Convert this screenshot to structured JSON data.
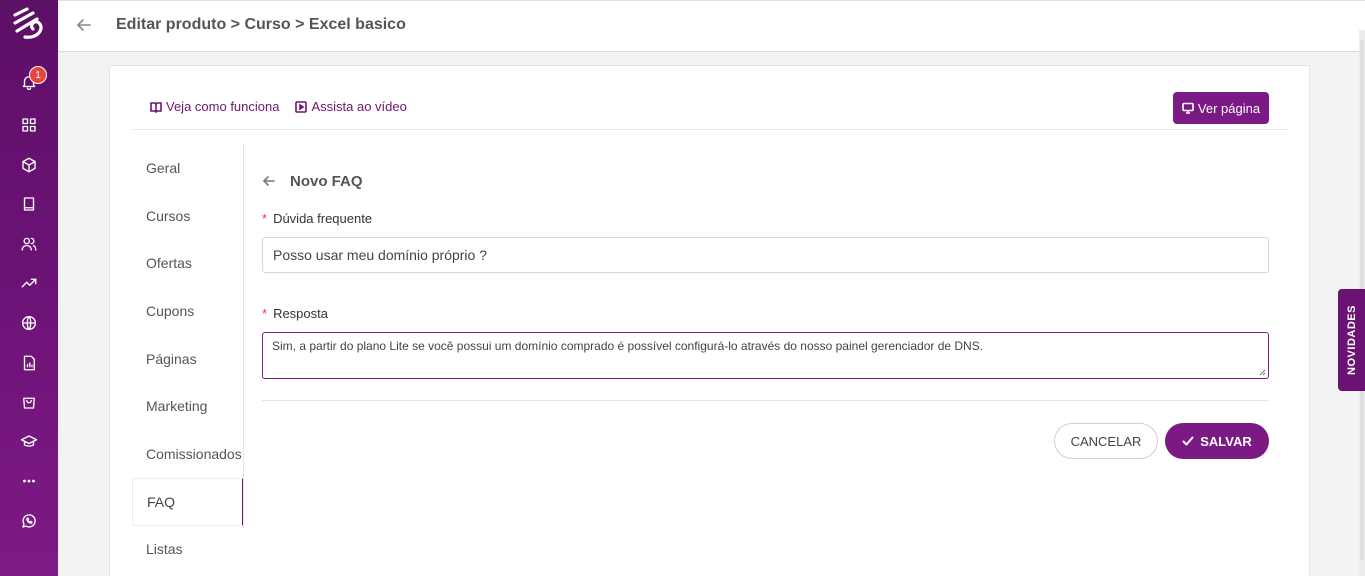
{
  "notifications": {
    "count": "1"
  },
  "header": {
    "breadcrumb": "Editar produto > Curso > Excel basico"
  },
  "toplinks": {
    "how_it_works": "Veja como funciona",
    "watch_video": "Assista ao vídeo"
  },
  "view_page_button": "Ver página",
  "tabs": [
    {
      "label": "Geral"
    },
    {
      "label": "Cursos"
    },
    {
      "label": "Ofertas"
    },
    {
      "label": "Cupons"
    },
    {
      "label": "Páginas"
    },
    {
      "label": "Marketing"
    },
    {
      "label": "Comissionados"
    },
    {
      "label": "FAQ"
    },
    {
      "label": "Listas"
    }
  ],
  "active_tab": "FAQ",
  "form": {
    "title": "Novo FAQ",
    "question_label": "Dúvida frequente",
    "question_value": "Posso usar meu domínio próprio ?",
    "answer_label": "Resposta",
    "answer_value": "Sim, a partir do plano Lite se você possui um domínio comprado é possível configurá-lo através do nosso painel gerenciador de DNS.",
    "required_mark": "*",
    "cancel_label": "CANCELAR",
    "save_label": "SALVAR"
  },
  "novidades_label": "NOVIDADES",
  "colors": {
    "primary": "#7b1a85",
    "sidebar": "#6b1275",
    "badge": "#e8453c"
  }
}
